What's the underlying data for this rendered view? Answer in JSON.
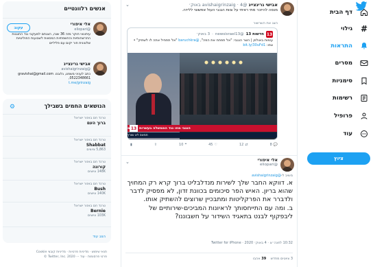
{
  "nav": {
    "items": [
      {
        "label": "דף הבית",
        "icon": "home-icon"
      },
      {
        "label": "גילוי",
        "icon": "hashtag-icon"
      },
      {
        "label": "התראות",
        "icon": "bell-icon",
        "active": true
      },
      {
        "label": "מסרים",
        "icon": "envelope-icon"
      },
      {
        "label": "סימניות",
        "icon": "bookmark-icon"
      },
      {
        "label": "רשימות",
        "icon": "list-icon"
      },
      {
        "label": "פרופיל",
        "icon": "person-icon"
      },
      {
        "label": "עוד",
        "icon": "more-circle-icon"
      }
    ],
    "tweet_button": "ציוץ",
    "accent": "#1da1f2"
  },
  "tweet1": {
    "name": "אבישי גרינצייג",
    "handle": "@avishaigrinzaig",
    "time": "4 באוק׳",
    "body": "מנסה להיזכר מתי ראיתי על צוות הגנבי העול אפשוצי ללידה.",
    "show_thread": "הצג את השרשור",
    "quote": {
      "source_name": "חדשות 13",
      "handle": "@newsisrael13",
      "time": "3 באוק׳",
      "body_a": "עימות באולפן | השר הנגבי: \"אל תפתח את הפה\", ",
      "body_mention": "@baruchkra",
      "body_b": " \"אל תתחיל אתה לו לשתיק\" • צפו: ",
      "body_link": "bit.ly/30uFd1",
      "ticker": "הנגבי מחו נגד הממשלה בעשרות צמתים",
      "ticker2": "חמאס לא שורץ",
      "channel": "13"
    },
    "actions": {
      "reply": "8",
      "retweet": "12",
      "like": "45",
      "quote_count": "10"
    }
  },
  "tweet2": {
    "name": "אלי איפורי",
    "handle": "@eliopari",
    "replying_prefix": "משיב ל-",
    "replying_to": "@avishaigrinzaig",
    "text": "א. דווקא החבר שלך לשירות מנדלבליט ברוך קרא רק המחויך שהוא בריון. האיש הפר סיכומים בכוונת זדון, לא מפסיק לדבר ולדברר את הפרקליטות ומתבכיין שרוצים להשתיק אותו.\nב. ומה עם התייחסותך לראיונות המביכים-שירותיים של ליבפקוף לבנט בתאגיד השידור על חשבוננו?",
    "timestamp": "10:32 לפנה״צ · 4 באוק׳ 2020 · Twitter for iPhone",
    "stats_prefix": "3 ציוטים מחדש",
    "likes_count": "39",
    "likes_label": "אהבו"
  },
  "sidebar": {
    "relevant_title": "אנשים רלוונטיים",
    "people": [
      {
        "name": "אלי איפורי",
        "handle": "@eliopari",
        "bio": "עיתונאי חוקר מזה 36 שנה, הצגתם למעקבי נגד החוגגות התרשחותיות והחשפתיות המסווות לשבועות הפוליטיות שלטונית חור יקום עם פליליים",
        "follow": "עקוב"
      },
      {
        "name": "אבישי גרינצייג",
        "handle": "@avishaigrinzaig",
        "bio": "כתב לעניני משפט, גלובס. gravishai@gmail.com ,0522348661",
        "link": "t.me/grinzaig"
      }
    ],
    "trends_title": "הנושאים החמים בשבילך",
    "trends": [
      {
        "context": "טרנד חם באזור ישראל",
        "name": "ברוך העם",
        "count": ""
      },
      {
        "context": "טרנד חם באזור ישראל",
        "name": "Shabbat",
        "count": "5,863 ציוצים"
      },
      {
        "context": "טרנד חם באזור ישראל",
        "name": "קורונה",
        "count": "148K ציוצים"
      },
      {
        "context": "טרנד חם באזור ישראל",
        "name": "Bush",
        "count": "140K ציוצים"
      },
      {
        "context": "טרנד חם באזור ישראל",
        "name": "Bernie",
        "count": "103K ציוצים"
      }
    ],
    "trends_more": "הצג עוד",
    "footer_1": "תנאי שימוש · מדיניות פרטיות · מדיניות קובצי Cookie",
    "footer_2": "פרטי פרסומות · עוד ··· Twitter, Inc. 2020 ©"
  }
}
